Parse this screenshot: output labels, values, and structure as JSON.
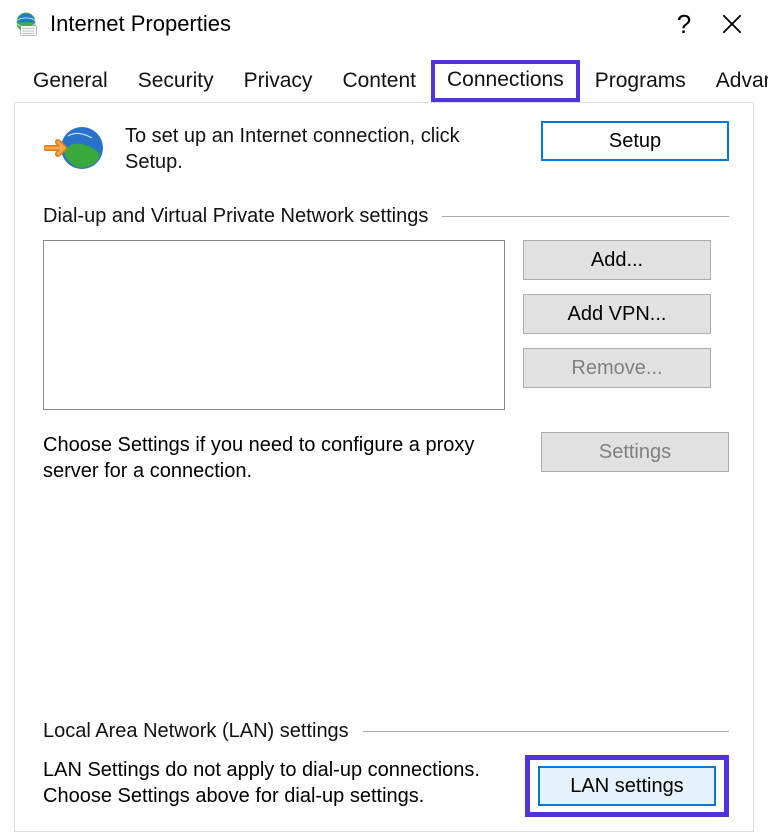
{
  "window": {
    "title": "Internet Properties"
  },
  "tabs": {
    "general": "General",
    "security": "Security",
    "privacy": "Privacy",
    "content": "Content",
    "connections": "Connections",
    "programs": "Programs",
    "advanced": "Advanced"
  },
  "setup_section": {
    "text": "To set up an Internet connection, click Setup.",
    "button": "Setup"
  },
  "dialup_section": {
    "header": "Dial-up and Virtual Private Network settings",
    "add_button": "Add...",
    "add_vpn_button": "Add VPN...",
    "remove_button": "Remove...",
    "choose_text": "Choose Settings if you need to configure a proxy server for a connection.",
    "settings_button": "Settings"
  },
  "lan_section": {
    "header": "Local Area Network (LAN) settings",
    "text": "LAN Settings do not apply to dial-up connections. Choose Settings above for dial-up settings.",
    "button": "LAN settings"
  }
}
